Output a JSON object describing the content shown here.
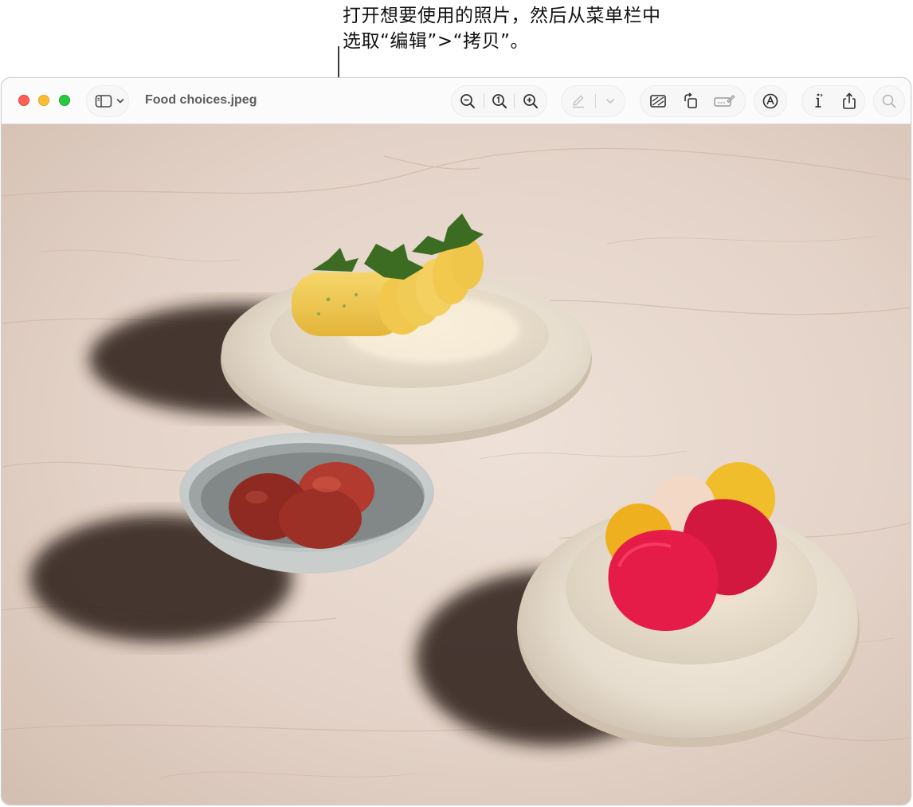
{
  "callout": {
    "line1": "打开想要使用的照片，然后从菜单栏中",
    "line2": "选取“编辑”>“拷贝”。"
  },
  "window": {
    "title": "Food choices.jpeg"
  },
  "toolbar": {
    "icons": [
      "sidebar-icon",
      "chevron-down-icon",
      "zoom-out-icon",
      "actual-size-icon",
      "zoom-in-icon",
      "highlight-pen-icon",
      "chevron-down-icon",
      "crop-icon",
      "rotate-icon",
      "sign-icon",
      "markup-icon",
      "info-icon",
      "share-icon",
      "search-icon"
    ]
  },
  "colors": {
    "close": "#fe5f57",
    "minimize": "#febc2e",
    "maximize": "#28c840"
  }
}
